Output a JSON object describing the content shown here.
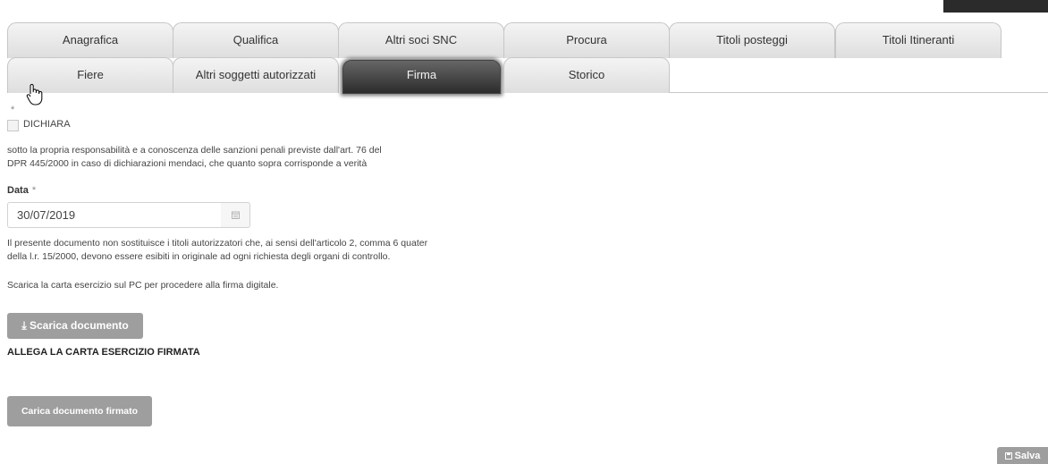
{
  "tabs_row1": [
    {
      "label": "Anagrafica"
    },
    {
      "label": "Qualifica"
    },
    {
      "label": "Altri soci SNC"
    },
    {
      "label": "Procura"
    },
    {
      "label": "Titoli posteggi"
    },
    {
      "label": "Titoli Itineranti"
    }
  ],
  "tabs_row2": [
    {
      "label": "Fiere"
    },
    {
      "label": "Altri soggetti autorizzati"
    },
    {
      "label": "Firma",
      "active": true
    },
    {
      "label": "Storico"
    }
  ],
  "form": {
    "required_marker": "*",
    "checkbox_label": "DICHIARA",
    "declaration_line1": "sotto la propria responsabilità e a conoscenza delle sanzioni penali previste dall'art. 76 del",
    "declaration_line2": "DPR 445/2000 in caso di dichiarazioni mendaci, che quanto sopra corrisponde a verità",
    "date_label": "Data",
    "date_value": "30/07/2019",
    "notice_line1": "Il presente documento non sostituisce i titoli autorizzatori che, ai sensi dell'articolo 2, comma 6 quater",
    "notice_line2": "della l.r. 15/2000, devono essere esibiti in originale ad ogni richiesta degli organi di controllo.",
    "download_hint": "Scarica la carta esercizio sul PC per procedere alla firma digitale.",
    "download_button": "Scarica documento",
    "attach_title": "ALLEGA LA CARTA ESERCIZIO FIRMATA",
    "upload_button": "Carica documento firmato",
    "save_button": "Salva"
  },
  "icons": {
    "download": "download-icon",
    "calendar": "calendar-icon",
    "save": "save-icon",
    "cursor": "hand-pointer-icon"
  }
}
